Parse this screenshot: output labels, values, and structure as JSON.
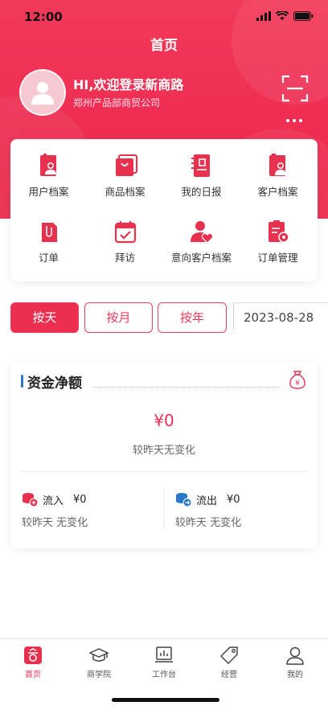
{
  "status_bar": {
    "time": "12:00"
  },
  "header": {
    "title": "首页",
    "greeting": "HI,欢迎登录新商路",
    "company": "郑州产品部商贸公司"
  },
  "menu": [
    {
      "label": "用户档案",
      "icon": "user-file-icon"
    },
    {
      "label": "商品档案",
      "icon": "shopping-bag-icon"
    },
    {
      "label": "我的日报",
      "icon": "daily-report-icon"
    },
    {
      "label": "客户档案",
      "icon": "customer-file-icon"
    },
    {
      "label": "订单",
      "icon": "order-icon"
    },
    {
      "label": "拜访",
      "icon": "calendar-check-icon"
    },
    {
      "label": "意向客户档案",
      "icon": "user-heart-icon"
    },
    {
      "label": "订单管理",
      "icon": "order-gear-icon"
    }
  ],
  "period_tabs": {
    "day": "按天",
    "month": "按月",
    "year": "按年",
    "selected": "按天"
  },
  "date": "2023-08-28",
  "fund": {
    "title": "资金净额",
    "amount": "¥0",
    "change": "较昨天无变化",
    "inflow_label": "流入",
    "inflow_value": "¥0",
    "inflow_change": "较昨天 无变化",
    "outflow_label": "流出",
    "outflow_value": "¥0",
    "outflow_change": "较昨天 无变化"
  },
  "tabbar": [
    {
      "label": "首页",
      "icon": "home-icon",
      "active": true
    },
    {
      "label": "商学院",
      "icon": "graduation-cap-icon",
      "active": false
    },
    {
      "label": "工作台",
      "icon": "workbench-icon",
      "active": false
    },
    {
      "label": "经营",
      "icon": "tag-icon",
      "active": false
    },
    {
      "label": "我的",
      "icon": "person-icon",
      "active": false
    }
  ],
  "colors": {
    "primary": "#EC2E51",
    "accent_blue": "#2A78C8"
  }
}
